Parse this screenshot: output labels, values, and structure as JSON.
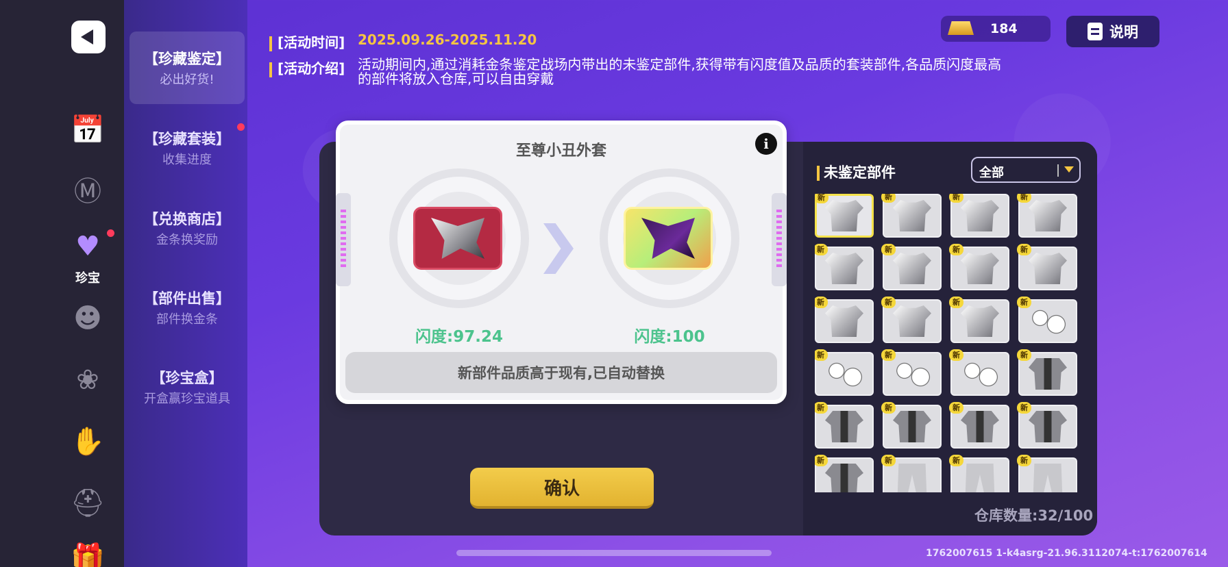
{
  "rail": {
    "active_label": "珍宝"
  },
  "categories": [
    {
      "title": "【珍藏鉴定】",
      "subtitle": "必出好货!"
    },
    {
      "title": "【珍藏套装】",
      "subtitle": "收集进度"
    },
    {
      "title": "【兑换商店】",
      "subtitle": "金条换奖励"
    },
    {
      "title": "【部件出售】",
      "subtitle": "部件换金条"
    },
    {
      "title": "【珍宝盒】",
      "subtitle": "开盒赢珍宝道具"
    }
  ],
  "event": {
    "time_label": "[活动时间]",
    "time_value": "2025.09.26-2025.11.20",
    "intro_label": "[活动介绍]",
    "intro_text": "活动期间内,通过消耗金条鉴定战场内带出的未鉴定部件,获得带有闪度值及品质的套装部件,各品质闪度最高的部件将放入仓库,可以自由穿戴"
  },
  "currency": {
    "gold": "184"
  },
  "help_button": "说明",
  "result": {
    "item_name": "至尊小丑外套",
    "old_shine": "闪度:97.24",
    "new_shine": "闪度:100",
    "notice": "新部件品质高于现有,已自动替换"
  },
  "confirm_button": "确认",
  "inventory": {
    "title": "未鉴定部件",
    "filter_selected": "全部",
    "new_badge": "新",
    "items": [
      "shirt",
      "shirt",
      "shirt",
      "shirt",
      "shirt",
      "shirt",
      "shirt",
      "shirt",
      "shirt",
      "shirt",
      "shirt",
      "gloves",
      "gloves",
      "gloves",
      "gloves",
      "suit",
      "suit",
      "suit",
      "suit",
      "suit",
      "suit",
      "pants",
      "pants",
      "pants"
    ],
    "storage": "仓库数量:32/100"
  },
  "debug_text": "1762007615  1-k4asrg-21.96.3112074-t:1762007614",
  "colors": {
    "accent": "#f5c542",
    "shine": "#4cc38d",
    "panel": "#2e2a45"
  }
}
